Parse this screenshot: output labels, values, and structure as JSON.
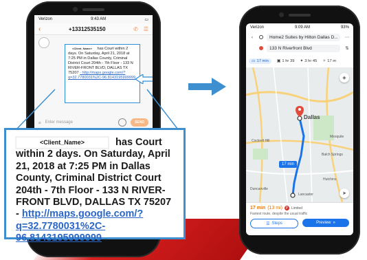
{
  "left_phone": {
    "status": {
      "carrier": "Verizon",
      "time": "9:43 AM"
    },
    "header": {
      "back_icon": "chevron-left-icon",
      "phone_number": "+13312535150",
      "call_icon": "phone-icon",
      "menu_icon": "menu-icon"
    },
    "message_small": {
      "name_tag": "<Client_Name>",
      "text_after_name": "has Court within 2 days. On Saturday, April 21, 2018 at 7:25 PM in Dallas County, Criminal District Court 204th - 7th Floor - 133 N RIVER-FRONT BLVD, DALLAS TX 75207",
      "link": "- http://maps.google.com/?q=32.7780031%2C-96.8143195999999"
    },
    "input": {
      "placeholder": "Enter message",
      "send_label": "SEND"
    }
  },
  "zoom": {
    "name_tag": "<Client_Name>",
    "text_after_name": "has Court",
    "body": "within 2 days.  On Saturday, April 21, 2018 at 7:25 PM in Dallas County, Criminal District Court 204th - 7th Floor - 133 N RIVER-FRONT BLVD, DALLAS TX 75207",
    "link_prefix": "- ",
    "link": "http://maps.google.com/?q=32.7780031%2C-96.8143195999999",
    "trailing": " ."
  },
  "right_phone": {
    "status": {
      "carrier": "Verizon",
      "time": "9:09 AM",
      "battery": "93%"
    },
    "origin": "Home2 Suites by Hilton Dallas D...",
    "destination": "133 N Riverfront Blvd",
    "modes": [
      {
        "icon": "car-icon",
        "label": "17 min"
      },
      {
        "icon": "transit-icon",
        "label": "1 hr 39"
      },
      {
        "icon": "walk-icon",
        "label": "3 hr 45"
      },
      {
        "icon": "bike-icon",
        "label": "17 m"
      }
    ],
    "map": {
      "city_label": "Dallas",
      "eta_chip": "17 min",
      "labels": [
        "Cockrell Hill",
        "Duncanville",
        "Lancaster",
        "Hutchins",
        "Balch Springs",
        "Mesquite"
      ]
    },
    "summary": {
      "time": "17 min",
      "distance": "(13 mi)",
      "toll_label": "Limited",
      "note": "Fastest route, despite the usual traffic",
      "steps_label": "Steps",
      "preview_label": "Preview"
    }
  },
  "colors": {
    "accent_blue": "#2d8fd8",
    "maps_blue": "#1a73e8",
    "orange": "#f08a48",
    "red": "#d81e1e"
  }
}
